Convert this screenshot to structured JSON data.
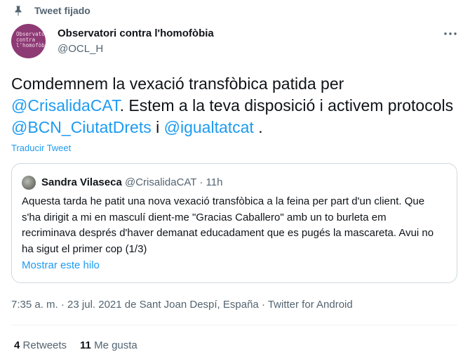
{
  "pinned": {
    "label": "Tweet fijado",
    "icon": "pin-icon"
  },
  "author": {
    "name": "Observatori contra l'homofòbia",
    "handle": "@OCL_H",
    "avatar_text": "Observatori\ncontra\nl'homofòbia",
    "avatar_color": "#8e3a75"
  },
  "more_icon": "more-horizontal-icon",
  "tweet": {
    "segments": [
      {
        "text": "Comdemnem la vexació transfòbica patida per ",
        "type": "text"
      },
      {
        "text": "@CrisalidaCAT",
        "type": "mention"
      },
      {
        "text": ". Estem a la teva disposició i activem protocols ",
        "type": "text"
      },
      {
        "text": "@BCN_CiutatDrets",
        "type": "mention"
      },
      {
        "text": " i ",
        "type": "text"
      },
      {
        "text": "@igualtatcat",
        "type": "mention"
      },
      {
        "text": " .",
        "type": "text"
      }
    ],
    "translate_label": "Traducir Tweet"
  },
  "quote": {
    "name": "Sandra Vilaseca",
    "handle": "@CrisalidaCAT",
    "separator": " · ",
    "time": "11h",
    "body": "Aquesta tarda he patit una nova vexació transfòbica a la feina per part d'un client. Que s'ha dirigit a mi en masculí dient-me \"Gracias Caballero\" amb un to burleta em recriminava després d'haver demanat educadament que es pugés la mascareta. Avui no ha sigut el primer cop (1/3)",
    "show_thread": "Mostrar este hilo"
  },
  "meta": {
    "time": "7:35 a. m.",
    "sep1": " · ",
    "date": "23 jul. 2021",
    "location_prefix": " de ",
    "location": "Sant Joan Despí, España",
    "sep2": " · ",
    "source": "Twitter for Android"
  },
  "stats": {
    "retweets_count": "4",
    "retweets_label": "Retweets",
    "likes_count": "11",
    "likes_label": "Me gusta"
  },
  "colors": {
    "accent": "#1d9bf0",
    "secondary_text": "#536471",
    "border": "#cfd9de"
  }
}
